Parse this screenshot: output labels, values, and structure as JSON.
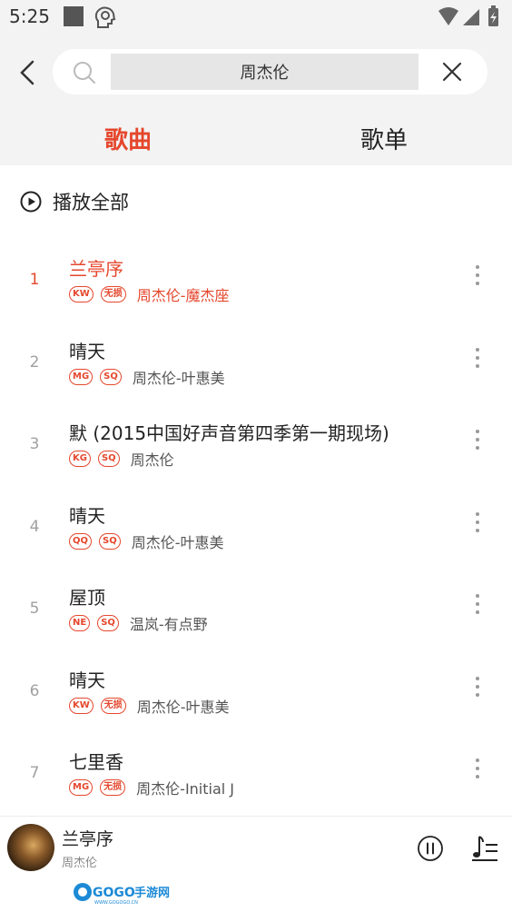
{
  "status_bar": {
    "time": "5:25"
  },
  "search": {
    "query": "周杰伦"
  },
  "tabs": [
    {
      "label": "歌曲",
      "active": true
    },
    {
      "label": "歌单",
      "active": false
    }
  ],
  "play_all": {
    "label": "播放全部"
  },
  "songs": [
    {
      "index": "1",
      "title": "兰亭序",
      "badges": [
        "KW",
        "无损"
      ],
      "artist": "周杰伦-魔杰座",
      "active": true
    },
    {
      "index": "2",
      "title": "晴天",
      "badges": [
        "MG",
        "SQ"
      ],
      "artist": "周杰伦-叶惠美",
      "active": false
    },
    {
      "index": "3",
      "title": "默 (2015中国好声音第四季第一期现场)",
      "badges": [
        "KG",
        "SQ"
      ],
      "artist": "周杰伦",
      "active": false
    },
    {
      "index": "4",
      "title": "晴天",
      "badges": [
        "QQ",
        "SQ"
      ],
      "artist": "周杰伦-叶惠美",
      "active": false
    },
    {
      "index": "5",
      "title": "屋顶",
      "badges": [
        "NE",
        "SQ"
      ],
      "artist": "温岚-有点野",
      "active": false
    },
    {
      "index": "6",
      "title": "晴天",
      "badges": [
        "KW",
        "无损"
      ],
      "artist": "周杰伦-叶惠美",
      "active": false
    },
    {
      "index": "7",
      "title": "七里香",
      "badges": [
        "MG",
        "无损"
      ],
      "artist": "周杰伦-Initial J",
      "active": false
    }
  ],
  "player": {
    "title": "兰亭序",
    "artist": "周杰伦"
  },
  "watermark": {
    "text": "GOGO手游网",
    "sub": "WWW.GOGOGO.CN"
  },
  "colors": {
    "accent": "#e5472d",
    "header_bg": "#f3f3f3"
  },
  "icons": {
    "back": "chevron-left-icon",
    "search": "search-icon",
    "clear": "close-icon",
    "play_all": "play-circle-icon",
    "more": "more-vertical-icon",
    "pause": "pause-circle-icon",
    "playlist": "playlist-icon"
  }
}
